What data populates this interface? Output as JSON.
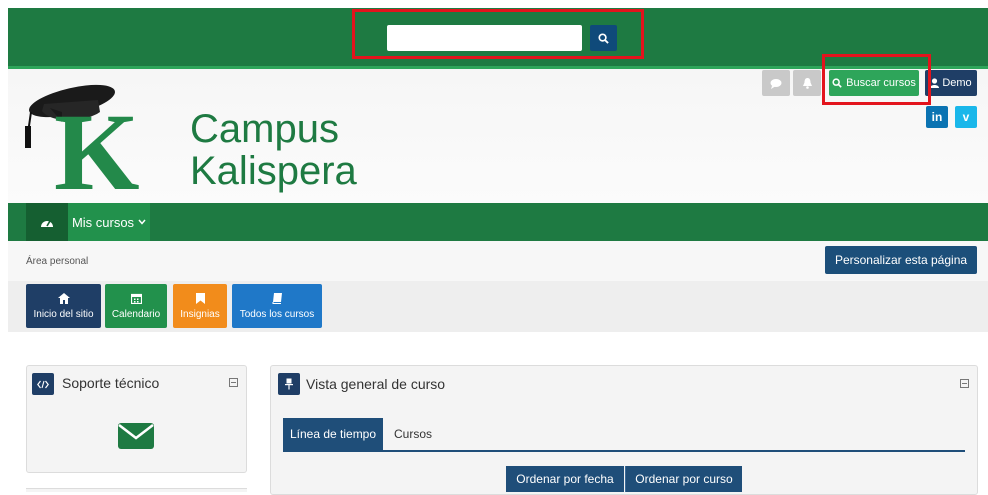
{
  "search": {
    "value": "",
    "placeholder": ""
  },
  "site": {
    "name_line1": "Campus",
    "name_line2": "Kalispera"
  },
  "header": {
    "search_courses_label": "Buscar cursos",
    "user_label": "Demo",
    "social": {
      "linkedin": "in",
      "vimeo": "v"
    }
  },
  "nav": {
    "my_courses_label": "Mis cursos"
  },
  "breadcrumb": "Área personal",
  "customize_label": "Personalizar esta página",
  "quick_links": [
    {
      "label": "Inicio del sitio",
      "icon": "home-icon",
      "color": "#1f3e66"
    },
    {
      "label": "Calendario",
      "icon": "calendar-icon",
      "color": "#22914c"
    },
    {
      "label": "Insignias",
      "icon": "bookmark-icon",
      "color": "#f28c1b"
    },
    {
      "label": "Todos los cursos",
      "icon": "book-icon",
      "color": "#1f78c8"
    }
  ],
  "support_block": {
    "title": "Soporte técnico"
  },
  "overview_block": {
    "title": "Vista general de curso",
    "tabs": [
      "Línea de tiempo",
      "Cursos"
    ],
    "sort": [
      "Ordenar por fecha",
      "Ordenar por curso"
    ]
  },
  "colors": {
    "brand_green": "#1e7a42",
    "dark_blue": "#1f4e79",
    "highlight_red": "#e3141d"
  }
}
